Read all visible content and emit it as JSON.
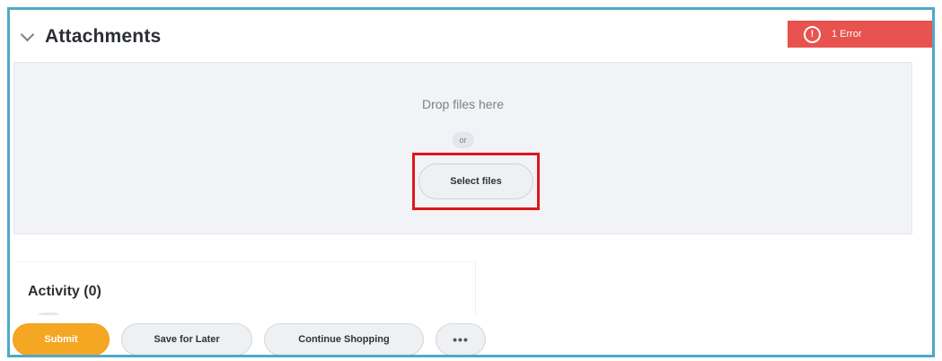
{
  "attachments": {
    "title": "Attachments",
    "error_badge": {
      "icon": "alert-circle-icon",
      "text": "1 Error",
      "color": "#e8524f"
    },
    "dropzone": {
      "drop_text": "Drop files here",
      "or_text": "or",
      "select_button": "Select files"
    }
  },
  "activity": {
    "title": "Activity (0)"
  },
  "actions": {
    "submit": "Submit",
    "save_for_later": "Save for Later",
    "continue_shopping": "Continue Shopping",
    "more": "•••"
  },
  "colors": {
    "frame": "#4fa9c9",
    "highlight": "#e0161d",
    "submit": "#f5a623"
  }
}
